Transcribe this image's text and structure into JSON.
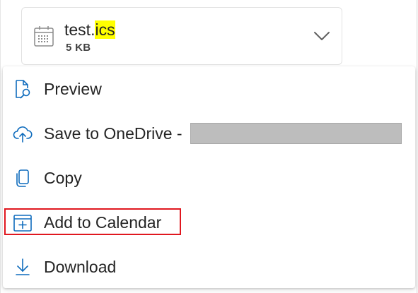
{
  "attachment": {
    "name_prefix": "test.",
    "name_highlight": "ics",
    "size": "5 KB",
    "icon": "calendar-file-icon",
    "expand_icon": "chevron-down-icon"
  },
  "menu": {
    "items": [
      {
        "label": "Preview",
        "icon": "document-search-icon"
      },
      {
        "label": "Save to OneDrive - ",
        "icon": "cloud-upload-icon"
      },
      {
        "label": "Copy",
        "icon": "copy-icon"
      },
      {
        "label": "Add to Calendar",
        "icon": "calendar-add-icon"
      },
      {
        "label": "Download",
        "icon": "download-icon"
      }
    ]
  },
  "colors": {
    "icon_blue": "#0f6cbd",
    "highlight_yellow": "#ffff00",
    "annotation_red": "#e0171f",
    "redaction_gray": "#bdbdbd"
  }
}
